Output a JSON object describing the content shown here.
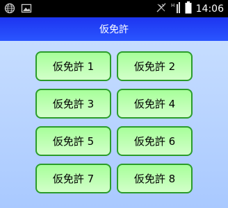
{
  "status_bar": {
    "time": "14:06",
    "icons": [
      "globe-icon",
      "image-icon",
      "signal-off-icon",
      "network-icon",
      "battery-icon"
    ]
  },
  "app_bar": {
    "title": "仮免許"
  },
  "buttons": [
    {
      "label": "仮免許 1"
    },
    {
      "label": "仮免許 2"
    },
    {
      "label": "仮免許 3"
    },
    {
      "label": "仮免許 4"
    },
    {
      "label": "仮免許 5"
    },
    {
      "label": "仮免許 6"
    },
    {
      "label": "仮免許 7"
    },
    {
      "label": "仮免許 8"
    }
  ],
  "colors": {
    "app_bar": "#1d35f0",
    "background": "#b8d4ff",
    "button_fill": "#b6ffab",
    "button_border": "#2a9c2a"
  }
}
